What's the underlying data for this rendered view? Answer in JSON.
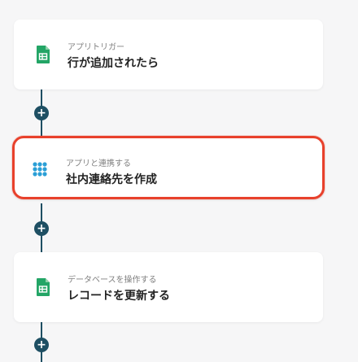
{
  "flow": {
    "steps": [
      {
        "subtitle": "アプリトリガー",
        "title": "行が追加されたら",
        "icon": "google-sheets-icon"
      },
      {
        "subtitle": "アプリと連携する",
        "title": "社内連絡先を作成",
        "icon": "app-grid-icon",
        "selected": true
      },
      {
        "subtitle": "データベースを操作する",
        "title": "レコードを更新する",
        "icon": "google-sheets-icon"
      }
    ],
    "add_button_label": "+"
  },
  "colors": {
    "connector": "#1e4f63",
    "selection_border": "#e8412c",
    "sheets_green": "#23a566",
    "grid_blue": "#2b9fd6"
  }
}
